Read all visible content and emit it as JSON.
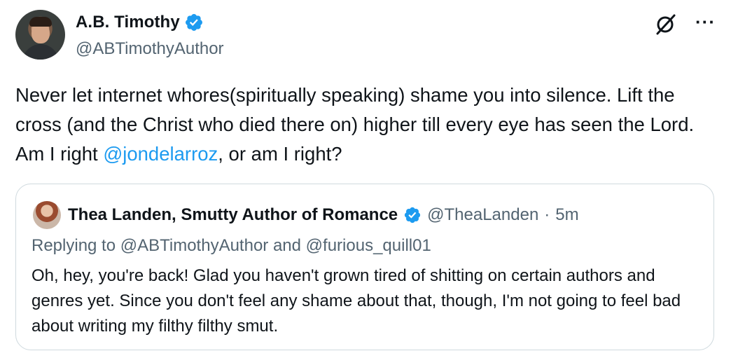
{
  "author": {
    "display_name": "A.B. Timothy",
    "handle": "@ABTimothyAuthor",
    "verified_icon": "verified-badge-icon"
  },
  "actions": {
    "grok_icon": "grok-icon",
    "more_label": "···"
  },
  "tweet": {
    "text_before": "Never let internet whores(spiritually speaking) shame you into silence. Lift the cross (and the Christ who died there on) higher till every eye has seen the Lord. Am I right ",
    "mention": "@jondelarroz",
    "text_after": ", or am I right?"
  },
  "quoted": {
    "display_name": "Thea Landen, Smutty Author of Romance",
    "handle": "@TheaLanden",
    "dot": "·",
    "time": "5m",
    "replying": "Replying to @ABTimothyAuthor and @furious_quill01",
    "text": "Oh, hey, you're back! Glad you haven't grown tired of shitting on certain authors and genres yet. Since you don't feel any shame about that, though, I'm not going to feel bad about writing my filthy filthy smut."
  },
  "colors": {
    "accent": "#1d9bf0",
    "text": "#0f1419",
    "secondary": "#536471",
    "border": "#cfd9de"
  }
}
